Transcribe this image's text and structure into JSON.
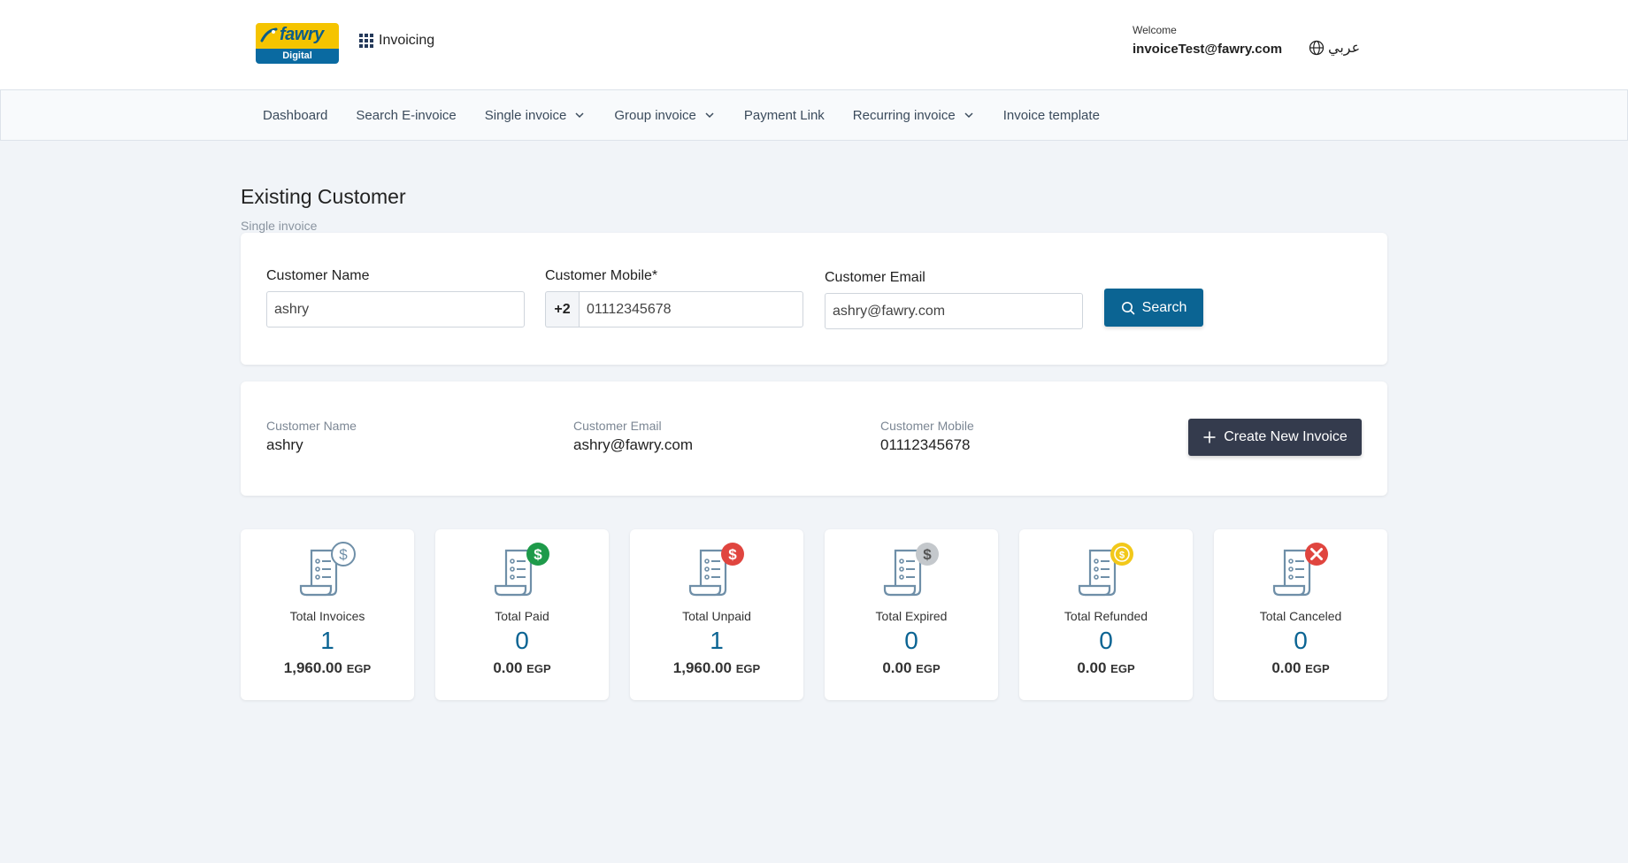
{
  "header": {
    "logo_brand": "fawry",
    "logo_sub": "Digital",
    "app_name": "Invoicing",
    "welcome_label": "Welcome",
    "user_email": "invoiceTest@fawry.com",
    "language": "عربي"
  },
  "nav": {
    "items": [
      {
        "label": "Dashboard"
      },
      {
        "label": "Search E-invoice"
      },
      {
        "label": "Single invoice"
      },
      {
        "label": "Group invoice"
      },
      {
        "label": "Payment Link"
      },
      {
        "label": "Recurring invoice"
      },
      {
        "label": "Invoice template"
      }
    ]
  },
  "page": {
    "title": "Existing Customer",
    "subtitle": "Single invoice"
  },
  "search": {
    "name_label": "Customer Name",
    "name_value": "ashry",
    "mobile_label": "Customer Mobile*",
    "mobile_prefix": "+2",
    "mobile_value": "01112345678",
    "email_label": "Customer Email",
    "email_value": "ashry@fawry.com",
    "search_button": "Search"
  },
  "customer": {
    "name_label": "Customer Name",
    "name": "ashry",
    "email_label": "Customer Email",
    "email": "ashry@fawry.com",
    "mobile_label": "Customer Mobile",
    "mobile": "01112345678",
    "create_button": "Create New Invoice"
  },
  "stats": [
    {
      "label": "Total Invoices",
      "count": "1",
      "amount": "1,960.00",
      "currency": "EGP",
      "icon": "receipt-dollar-icon",
      "badge_color": "#ffffff"
    },
    {
      "label": "Total Paid",
      "count": "0",
      "amount": "0.00",
      "currency": "EGP",
      "icon": "receipt-paid-icon",
      "badge_color": "#1e9a4a"
    },
    {
      "label": "Total Unpaid",
      "count": "1",
      "amount": "1,960.00",
      "currency": "EGP",
      "icon": "receipt-unpaid-icon",
      "badge_color": "#e0453f"
    },
    {
      "label": "Total Expired",
      "count": "0",
      "amount": "0.00",
      "currency": "EGP",
      "icon": "receipt-expired-icon",
      "badge_color": "#c4c8cc"
    },
    {
      "label": "Total Refunded",
      "count": "0",
      "amount": "0.00",
      "currency": "EGP",
      "icon": "receipt-refunded-icon",
      "badge_color": "#f2c81a"
    },
    {
      "label": "Total Canceled",
      "count": "0",
      "amount": "0.00",
      "currency": "EGP",
      "icon": "receipt-canceled-icon",
      "badge_color": "#e0453f"
    }
  ],
  "colors": {
    "primary": "#0b6493",
    "dark_button": "#343b4d",
    "background": "#f1f4f8"
  }
}
